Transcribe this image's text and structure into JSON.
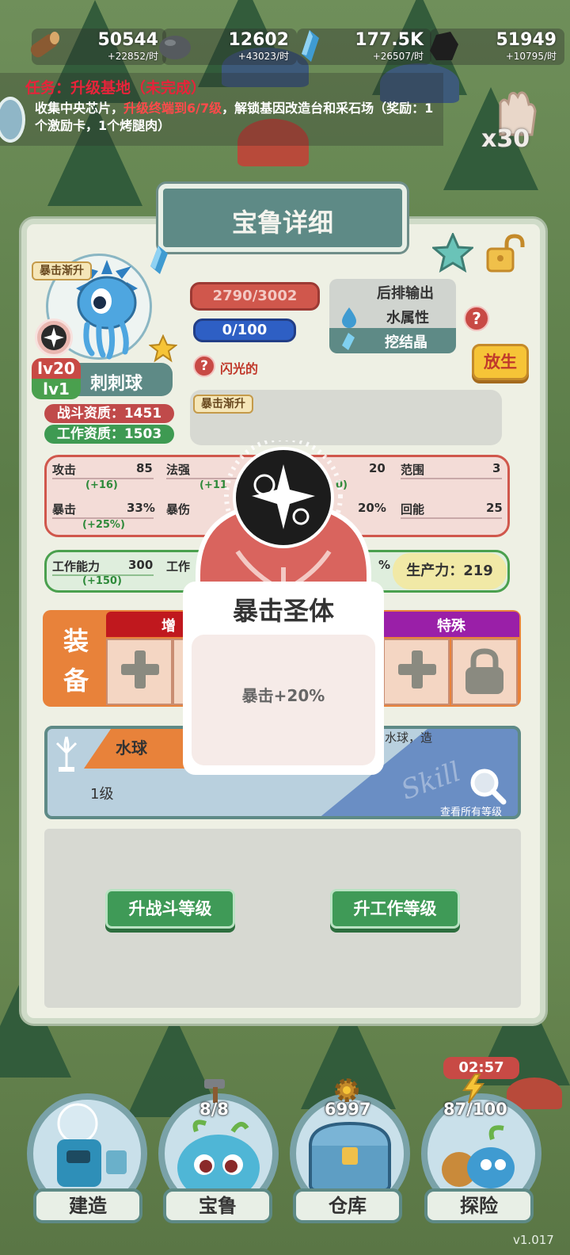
{
  "resources": [
    {
      "name": "wood",
      "value": "50544",
      "rate": "+22852/时",
      "color": "#8a5a32"
    },
    {
      "name": "stone",
      "value": "12602",
      "rate": "+43023/时",
      "color": "#555a5e"
    },
    {
      "name": "crystal",
      "value": "177.5K",
      "rate": "+26507/时",
      "color": "#3f9bd1"
    },
    {
      "name": "coal",
      "value": "51949",
      "rate": "+10795/时",
      "color": "#1e1e1e"
    }
  ],
  "quest": {
    "title": "任务：升级基地（未完成）",
    "text_a": "收集中央芯片，",
    "text_red": "升级终端到6/7级",
    "text_b": "，解锁基因改造台和采石场（奖励：1个激励卡，1个烤腿肉）"
  },
  "hand_count": "x30",
  "panel": {
    "title": "宝鲁详细",
    "trait_tag": "暴击渐升",
    "hp": "2790/3002",
    "exp": "0/100",
    "role": "后排输出",
    "element": "水属性",
    "work": "挖结晶",
    "release": "放生",
    "shiny": "闪光的",
    "level_combat": "lv20",
    "level_work": "lv1",
    "pet_name": "刺刺球",
    "combat_aptitude": "战斗资质：1451",
    "work_aptitude": "工作资质：1503",
    "trait_box_tag": "暴击渐升"
  },
  "combat_stats": {
    "attack_label": "攻击",
    "attack_value": "85",
    "attack_bonus": "(+16)",
    "magic_label": "法强",
    "magic_bonus": "(+11",
    "r3_value": "20",
    "r3_bonus": "0)",
    "range_label": "范围",
    "range_value": "3",
    "crit_label": "暴击",
    "crit_value": "33%",
    "crit_bonus": "(+25%)",
    "critdmg_label": "暴伤",
    "r7_value": "20%",
    "regen_label": "回能",
    "regen_value": "25"
  },
  "work_stats": {
    "ability_label": "工作能力",
    "ability_value": "300",
    "ability_bonus": "(+150)",
    "work2_label": "工作",
    "pct": "%",
    "production": "生产力：219"
  },
  "equip": {
    "label_a": "装",
    "label_b": "备",
    "boost": "增",
    "special": "特殊"
  },
  "skill": {
    "name": "水球",
    "level": "1级",
    "desc": "水球，造",
    "watermark": "Skill",
    "view_all": "查看所有等级"
  },
  "buttons": {
    "combat_up": "升战斗等级",
    "work_up": "升工作等级"
  },
  "popup": {
    "title": "暴击圣体",
    "desc": "暴击+20%"
  },
  "nav": {
    "timer": "02:57",
    "items": [
      {
        "label": "建造",
        "count": ""
      },
      {
        "label": "宝鲁",
        "count": "8/8"
      },
      {
        "label": "仓库",
        "count": "6997"
      },
      {
        "label": "探险",
        "count": "87/100"
      }
    ]
  },
  "version": "v1.017"
}
